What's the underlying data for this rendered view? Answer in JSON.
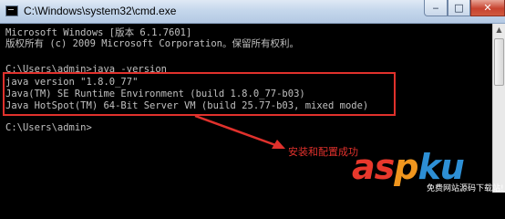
{
  "window": {
    "title": "C:\\Windows\\system32\\cmd.exe",
    "controls": {
      "minimize": "‒",
      "maximize": "□",
      "close": "✕"
    }
  },
  "console": {
    "lines": [
      "Microsoft Windows [版本 6.1.7601]",
      "版权所有 (c) 2009 Microsoft Corporation。保留所有权利。",
      "C:\\Users\\admin>java -version",
      "java version \"1.8.0_77\"",
      "Java(TM) SE Runtime Environment (build 1.8.0_77-b03)",
      "Java HotSpot(TM) 64-Bit Server VM (build 25.77-b03, mixed mode)",
      "C:\\Users\\admin>"
    ]
  },
  "annotation": {
    "text": "安装和配置成功",
    "color": "#e0312c"
  },
  "watermark": {
    "a": "a",
    "s": "s",
    "p": "p",
    "k": "k",
    "u": "u",
    "subtitle": "免费网站源码下载站!"
  },
  "colors": {
    "console_bg": "#000000",
    "console_text": "#c0c0c0",
    "highlight": "#e0312c"
  }
}
